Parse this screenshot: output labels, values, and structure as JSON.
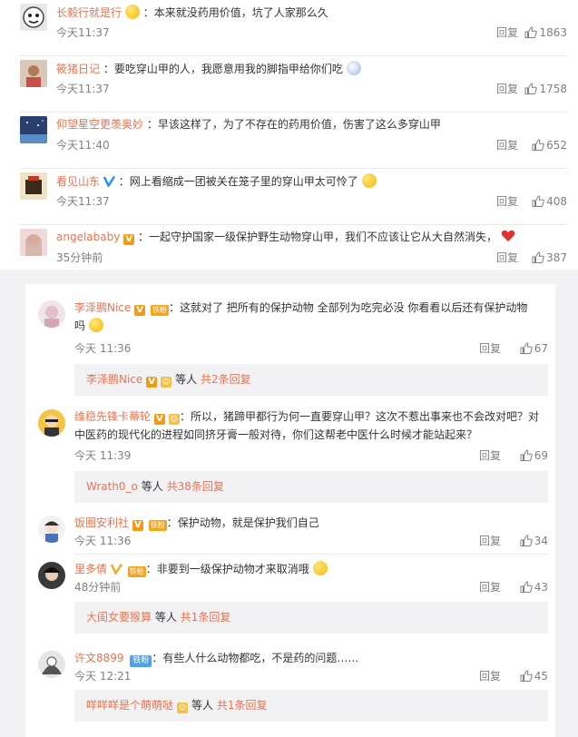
{
  "top_comments": [
    {
      "user": "长毅行就是行",
      "text": "本来就没药用价值，坑了人家那么久",
      "time": "今天11:37",
      "reply": "回复",
      "likes": "1863"
    },
    {
      "user": "筱猪日记",
      "text": "要吃穿山甲的人，我愿意用我的脚指甲给你们吃",
      "time": "今天11:37",
      "reply": "回复",
      "likes": "1758"
    },
    {
      "user": "仰望星空更羡奥妙",
      "text": "早该这样了，为了不存在的药用价值，伤害了这么多穿山甲",
      "time": "今天11:40",
      "reply": "回复",
      "likes": "652"
    },
    {
      "user": "看见山东",
      "text": "网上看缩成一团被关在笼子里的穿山甲太可怜了",
      "time": "今天11:37",
      "reply": "回复",
      "likes": "408"
    },
    {
      "user": "angelababy",
      "text": "一起守护国家一级保护野生动物穿山甲，我们不应该让它从大自然消失，",
      "time": "35分钟前",
      "reply": "回复",
      "likes": "387"
    }
  ],
  "comments": [
    {
      "user": "李泽鹏Nice",
      "badge": "铁粉",
      "text_line1": "这就对了 把所有的保护动物 全部列为吃完必没   你看看以后还有保护动物",
      "text_line2": "吗",
      "time": "今天 11:36",
      "reply": "回复",
      "likes": "67",
      "sub_user": "李泽鹏Nice",
      "sub_text": "等人",
      "sub_count": "共2条回复"
    },
    {
      "user": "维稳先锋卡蒂轮",
      "badge": "",
      "text_line1": "所以，猪蹄甲都行为何一直要穿山甲？这次不惹出事来也不会改对吧？对",
      "text_line2": "中医药的现代化的进程如同挤牙膏一般对待，你们这帮老中医什么时候才能站起来？",
      "time": "今天 11:39",
      "reply": "回复",
      "likes": "69",
      "sub_user": "Wrath0_o",
      "sub_text": "等人",
      "sub_count": "共38条回复"
    },
    {
      "user": "饭圈安利社",
      "badge": "铁粉",
      "text_line1": "保护动物，就是保护我们自己",
      "time": "今天 11:36",
      "reply": "回复",
      "likes": "34"
    },
    {
      "user": "里多倩",
      "badge": "铁粉",
      "text_line1": "非要到一级保护动物才来取消哦",
      "time": "48分钟前",
      "reply": "回复",
      "likes": "43",
      "sub_user": "大闺女要猴算",
      "sub_text": "等人",
      "sub_count": "共1条回复"
    },
    {
      "user": "许文8899",
      "badge": "铁粉",
      "text_line1": "有些人什么动物都吃，不是药的问题……",
      "time": "今天 12:21",
      "reply": "回复",
      "likes": "45",
      "sub_user": "咩咩咩是个萌萌哒",
      "sub_text": "等人",
      "sub_count": "共1条回复"
    }
  ],
  "verify_mark": "V",
  "colors": {
    "username": "#eb7350",
    "meta": "#808080",
    "panel": "#f2f2f5"
  }
}
